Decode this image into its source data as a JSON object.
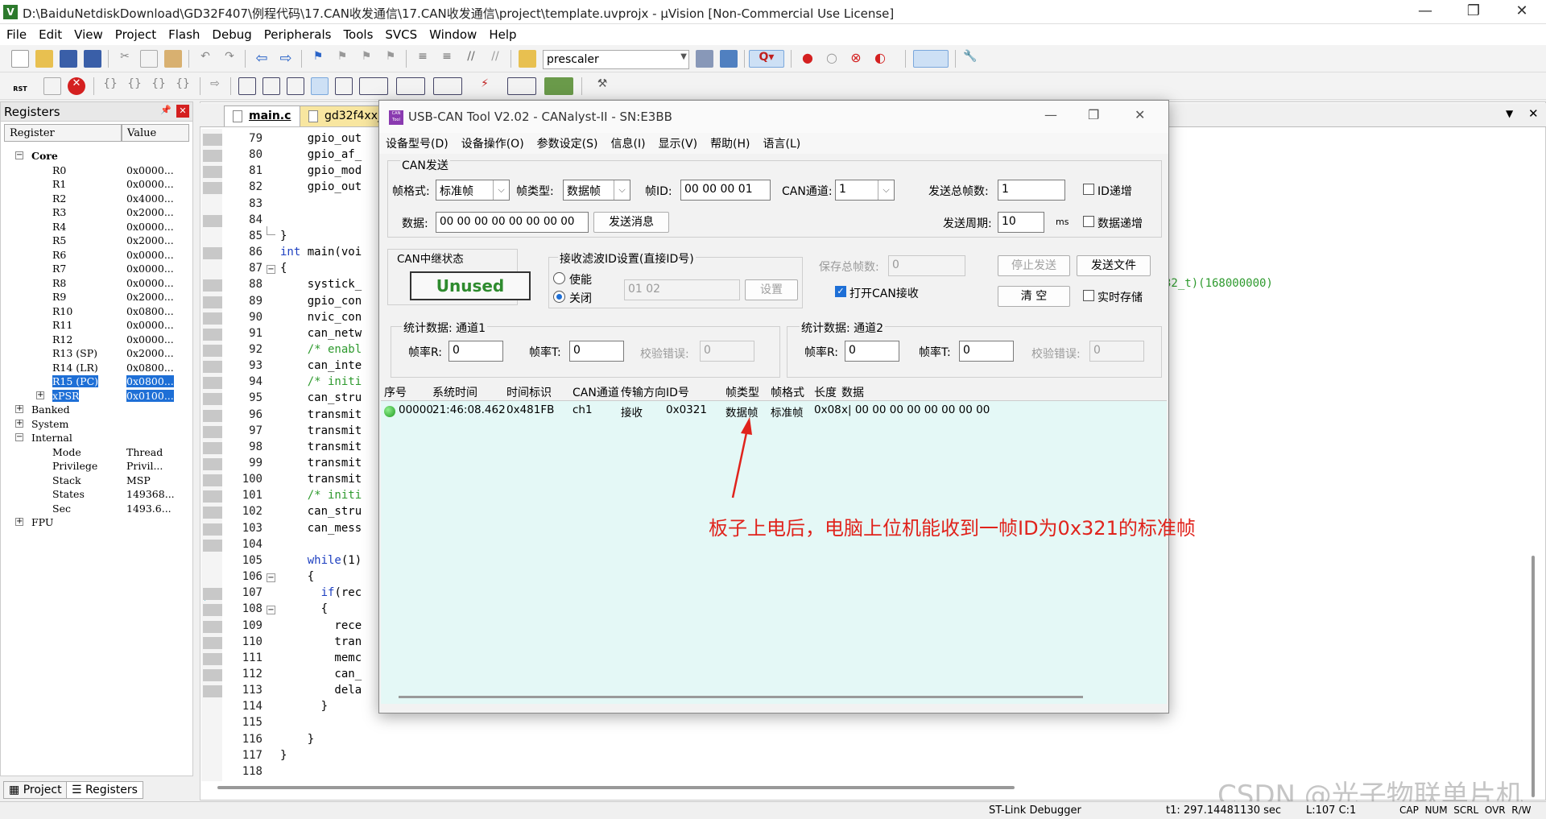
{
  "window": {
    "title": "D:\\BaiduNetdiskDownload\\GD32F407\\例程代码\\17.CAN收发通信\\17.CAN收发通信\\project\\template.uvprojx - µVision  [Non-Commercial Use License]",
    "app_icon_label": "V",
    "minimize_glyph": "—",
    "maximize_glyph": "❐",
    "close_glyph": "✕"
  },
  "menu": [
    "File",
    "Edit",
    "View",
    "Project",
    "Flash",
    "Debug",
    "Peripherals",
    "Tools",
    "SVCS",
    "Window",
    "Help"
  ],
  "toolbar": {
    "find_value": "prescaler",
    "reset_label": "RST"
  },
  "registers_panel": {
    "title": "Registers",
    "pin_glyph": "📌",
    "close_glyph": "✕",
    "col_register": "Register",
    "col_value": "Value",
    "groups": {
      "core": "Core",
      "banked": "Banked",
      "system": "System",
      "internal": "Internal",
      "fpu": "FPU"
    },
    "core_regs": [
      {
        "name": "R0",
        "value": "0x0000..."
      },
      {
        "name": "R1",
        "value": "0x0000..."
      },
      {
        "name": "R2",
        "value": "0x4000..."
      },
      {
        "name": "R3",
        "value": "0x2000..."
      },
      {
        "name": "R4",
        "value": "0x0000..."
      },
      {
        "name": "R5",
        "value": "0x2000..."
      },
      {
        "name": "R6",
        "value": "0x0000..."
      },
      {
        "name": "R7",
        "value": "0x0000..."
      },
      {
        "name": "R8",
        "value": "0x0000..."
      },
      {
        "name": "R9",
        "value": "0x2000..."
      },
      {
        "name": "R10",
        "value": "0x0800..."
      },
      {
        "name": "R11",
        "value": "0x0000..."
      },
      {
        "name": "R12",
        "value": "0x0000..."
      },
      {
        "name": "R13 (SP)",
        "value": "0x2000..."
      },
      {
        "name": "R14 (LR)",
        "value": "0x0800..."
      },
      {
        "name": "R15 (PC)",
        "value": "0x0800..."
      },
      {
        "name": "xPSR",
        "value": "0x0100..."
      }
    ],
    "internal_regs": [
      {
        "name": "Mode",
        "value": "Thread"
      },
      {
        "name": "Privilege",
        "value": "Privil..."
      },
      {
        "name": "Stack",
        "value": "MSP"
      },
      {
        "name": "States",
        "value": "149368..."
      },
      {
        "name": "Sec",
        "value": "1493.6..."
      }
    ],
    "bottom_tabs": [
      "Project",
      "Registers"
    ]
  },
  "editor": {
    "tabs": [
      "main.c",
      "gd32f4xx_"
    ],
    "line_numbers": [
      "79",
      "80",
      "81",
      "82",
      "83",
      "84",
      "85",
      "86",
      "87",
      "88",
      "89",
      "90",
      "91",
      "92",
      "93",
      "94",
      "95",
      "96",
      "97",
      "98",
      "99",
      "100",
      "101",
      "102",
      "103",
      "104",
      "105",
      "106",
      "107",
      "108",
      "109",
      "110",
      "111",
      "112",
      "113",
      "114",
      "115",
      "116",
      "117",
      "118"
    ],
    "lines": {
      "l79": "    gpio_out",
      "l80": "    gpio_af_",
      "l81": "    gpio_mod",
      "l82": "    gpio_out",
      "l85": "}",
      "l86_kw": "int",
      "l86": " main(voi",
      "l87": "{",
      "l88": "    systick_",
      "l89": "    gpio_con",
      "l90": "    nvic_con",
      "l91": "    can_netw",
      "l92": "    /* enabl",
      "l93": "    can_inte",
      "l94": "    /* initi",
      "l95": "    can_stru",
      "l96": "    transmit",
      "l97": "    transmit",
      "l98": "    transmit",
      "l99": "    transmit",
      "l100": "    transmit",
      "l101": "    /* initi",
      "l102": "    can_stru",
      "l103": "    can_mess",
      "l105_kw": "    while",
      "l105": "(1)",
      "l106": "    {",
      "l107_kw": "      if",
      "l107": "(rec",
      "l108": "      {",
      "l109": "        rece",
      "l110": "        tran",
      "l111": "        memc",
      "l112": "        can_",
      "l113": "        dela",
      "l114": "      }",
      "l116": "    }",
      "l117": "}",
      "right_fragment": "32_t)(168000000)"
    }
  },
  "can_tool": {
    "title": "USB-CAN Tool V2.02 - CANalyst-II - SN:E3BB",
    "icon_label": "CAN Tool",
    "menu": [
      "设备型号(D)",
      "设备操作(O)",
      "参数设定(S)",
      "信息(I)",
      "显示(V)",
      "帮助(H)",
      "语言(L)"
    ],
    "send": {
      "group_title": "CAN发送",
      "frame_format_label": "帧格式:",
      "frame_format_value": "标准帧",
      "frame_type_label": "帧类型:",
      "frame_type_value": "数据帧",
      "frame_id_label": "帧ID:",
      "frame_id_value": "00 00 00 01",
      "can_channel_label": "CAN通道:",
      "can_channel_value": "1",
      "total_frames_label": "发送总帧数:",
      "total_frames_value": "1",
      "id_increment_label": "ID递增",
      "data_label": "数据:",
      "data_value": "00 00 00 00 00 00 00 00",
      "send_button": "发送消息",
      "period_label": "发送周期:",
      "period_value": "10",
      "period_unit": "ms",
      "data_increment_label": "数据递增"
    },
    "relay": {
      "title": "CAN中继状态",
      "status": "Unused"
    },
    "filter": {
      "title": "接收滤波ID设置(直接ID号)",
      "enable_label": "使能",
      "disable_label": "关闭",
      "ids_value": "01 02",
      "set_button": "设置"
    },
    "right_controls": {
      "saved_frames_label": "保存总帧数:",
      "saved_frames_value": "0",
      "stop_send_button": "停止发送",
      "send_file_button": "发送文件",
      "open_receive_label": "打开CAN接收",
      "clear_button": "清 空",
      "realtime_save_label": "实时存储"
    },
    "stats1": {
      "title": "统计数据: 通道1",
      "rate_r_label": "帧率R:",
      "rate_r": "0",
      "rate_t_label": "帧率T:",
      "rate_t": "0",
      "err_label": "校验错误:",
      "err": "0"
    },
    "stats2": {
      "title": "统计数据: 通道2",
      "rate_r_label": "帧率R:",
      "rate_r": "0",
      "rate_t_label": "帧率T:",
      "rate_t": "0",
      "err_label": "校验错误:",
      "err": "0"
    },
    "grid": {
      "headers": [
        "序号",
        "系统时间",
        "时间标识",
        "CAN通道",
        "传输方向",
        "ID号",
        "帧类型",
        "帧格式",
        "长度",
        "数据"
      ],
      "rows": [
        {
          "seq": "00000",
          "time": "21:46:08.462",
          "stamp": "0x481FB",
          "channel": "ch1",
          "direction": "接收",
          "id": "0x0321",
          "type": "数据帧",
          "format": "标准帧",
          "length": "0x08",
          "data": "x| 00 00 00 00 00 00 00 00"
        }
      ]
    }
  },
  "annotation": "板子上电后，电脑上位机能收到一帧ID为0x321的标准帧",
  "watermark": "CSDN @光子物联单片机",
  "statusbar": {
    "debugger": "ST-Link Debugger",
    "time": "t1: 297.14481130 sec",
    "position": "L:107 C:1",
    "indicators": "CAP  NUM  SCRL  OVR  R/W"
  },
  "colors": {
    "selection": "#1e6fd6",
    "relay_text": "#2e8b2e",
    "annotation": "#e0231c",
    "grid_bg": "#e4f8f6"
  }
}
